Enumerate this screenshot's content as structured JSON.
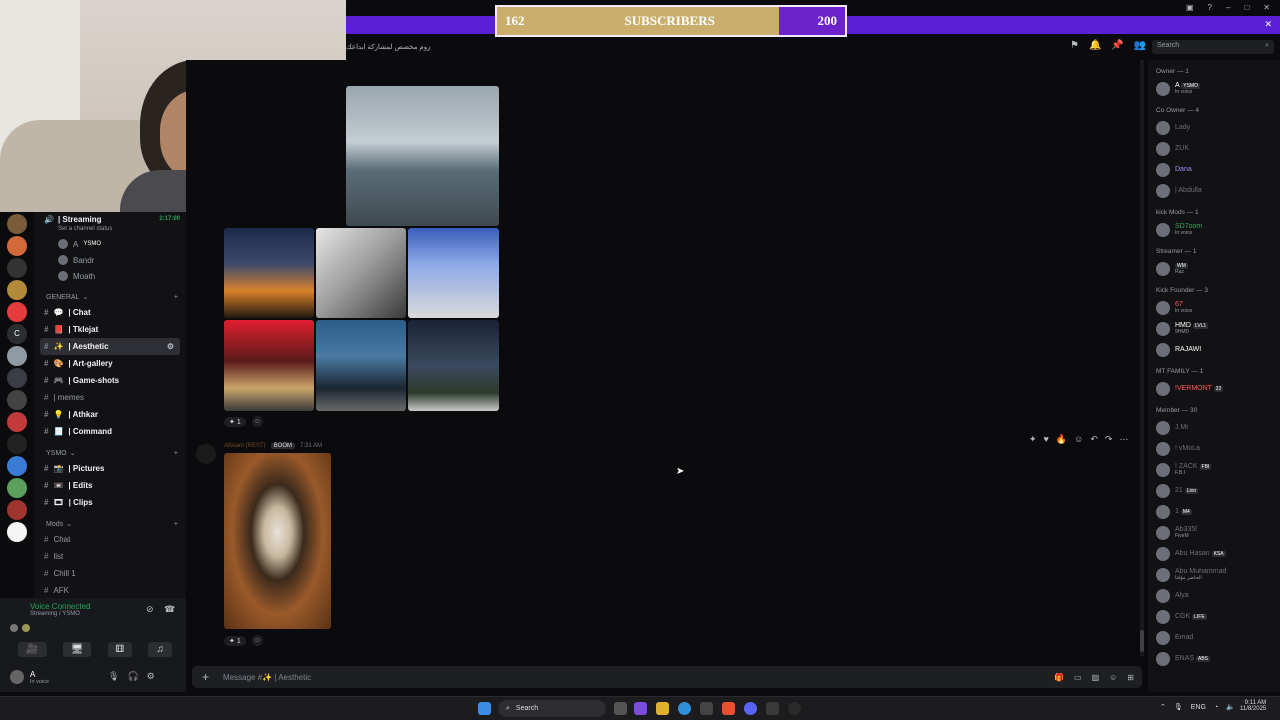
{
  "overlay": {
    "subs_current": "162",
    "subs_label": "SUBSCRIBERS",
    "subs_goal": "200",
    "subs_progress": 0.81
  },
  "channel_header": {
    "topic": "زوم مخصص لمشاركة ابداعك"
  },
  "search": {
    "placeholder": "Search"
  },
  "voice_channel": {
    "name": "| Streaming",
    "status": "Set a channel status",
    "timer": "2:17:00",
    "members": [
      {
        "name": "A",
        "badge": "YSMO"
      },
      {
        "name": "Bandr"
      },
      {
        "name": "Moath"
      }
    ]
  },
  "categories": [
    {
      "label": "GENERAL",
      "channels": [
        {
          "icon": "💬",
          "label": "| Chat"
        },
        {
          "icon": "📕",
          "label": "| Tklejat"
        },
        {
          "icon": "✨",
          "label": "| Aesthetic",
          "selected": true
        },
        {
          "icon": "🎨",
          "label": "| Art-gallery"
        },
        {
          "icon": "🎮",
          "label": "| Game-shots"
        },
        {
          "icon": "",
          "label": "| memes"
        },
        {
          "icon": "💡",
          "label": "| Athkar"
        },
        {
          "icon": "🧾",
          "label": "| Command"
        }
      ]
    },
    {
      "label": "YSMO",
      "channels": [
        {
          "icon": "📸",
          "label": "| Pictures"
        },
        {
          "icon": "📼",
          "label": "| Edits"
        },
        {
          "icon": "🎞",
          "label": "| Clips"
        }
      ]
    },
    {
      "label": "Mods",
      "channels": [
        {
          "icon": "",
          "label": "Chat"
        },
        {
          "icon": "",
          "label": "list"
        },
        {
          "icon": "",
          "label": "Chill 1"
        },
        {
          "icon": "",
          "label": "AFK"
        }
      ]
    }
  ],
  "voice_panel": {
    "status": "Voice Connected",
    "location": "Streaming / YSMO"
  },
  "user_panel": {
    "name": "A",
    "status": "In voice"
  },
  "message_top": {
    "reactions": "1"
  },
  "message_cat": {
    "author": "Albsam (REST)",
    "tag": "BOOM",
    "time": "7:31 AM",
    "reactions": "1"
  },
  "message_input": {
    "placeholder": "Message #✨ | Aesthetic"
  },
  "member_groups": [
    {
      "label": "Owner — 1",
      "members": [
        {
          "name": "A",
          "sub": "In voice",
          "badge": "YSMO",
          "color": "#ffffff"
        }
      ]
    },
    {
      "label": "Co Owner — 4",
      "members": [
        {
          "name": "Lady",
          "color": "#6d6f78"
        },
        {
          "name": "ZUK",
          "color": "#6d6f78"
        },
        {
          "name": "Dana",
          "color": "#a78bfa"
        },
        {
          "name": "| Abdulla",
          "color": "#6d6f78"
        }
      ]
    },
    {
      "label": "kick Mods — 1",
      "members": [
        {
          "name": "SD7oom",
          "sub": "In voice",
          "color": "#3ba55d"
        }
      ]
    },
    {
      "label": "Streamer — 1",
      "members": [
        {
          "name": "",
          "sub": "Raz",
          "badge": "WM",
          "color": "#ffffff"
        }
      ]
    },
    {
      "label": "Kick Founder — 3",
      "members": [
        {
          "name": "67",
          "sub": "In voice",
          "color": "#ff5a5a"
        },
        {
          "name": "HMD",
          "sub": "9HMD",
          "badge": "LVL1",
          "color": "#ffffff"
        },
        {
          "name": "RAJAWI",
          "color": "#ffffff"
        }
      ]
    },
    {
      "label": "MT FAMILY — 1",
      "members": [
        {
          "name": "!VERMONT",
          "badge": "22",
          "color": "#ff5a5a"
        }
      ]
    },
    {
      "label": "Member — 30",
      "members": [
        {
          "name": "J.Mr",
          "color": "#6d6f78"
        },
        {
          "name": "! vMoLa",
          "color": "#6d6f78"
        },
        {
          "name": "! ZACK",
          "sub": "F.B.I",
          "badge": "FBI",
          "color": "#6d6f78"
        },
        {
          "name": "21",
          "badge": "Lion",
          "color": "#6d6f78"
        },
        {
          "name": "1",
          "badge": "M4",
          "color": "#6d6f78"
        },
        {
          "name": "Ab335l",
          "sub": "FiveM",
          "color": "#6d6f78"
        },
        {
          "name": "Abu Hasan",
          "badge": "KSA",
          "color": "#6d6f78"
        },
        {
          "name": "Abu Muhammad",
          "sub": "الحاضر مؤقتا",
          "color": "#6d6f78"
        },
        {
          "name": "Alya",
          "color": "#6d6f78"
        },
        {
          "name": "CGK",
          "badge": "LIFE",
          "color": "#6d6f78"
        },
        {
          "name": "Emad",
          "color": "#6d6f78"
        },
        {
          "name": "ENAS",
          "badge": "ABS",
          "color": "#6d6f78"
        }
      ]
    }
  ],
  "taskbar": {
    "search_label": "Search",
    "lang": "ENG",
    "time": "9:11 AM",
    "date": "11/8/2025"
  },
  "colors": {
    "accent": "#5b1fd6",
    "gold": "#c9ae6d",
    "bg": "#0b0b0d"
  }
}
